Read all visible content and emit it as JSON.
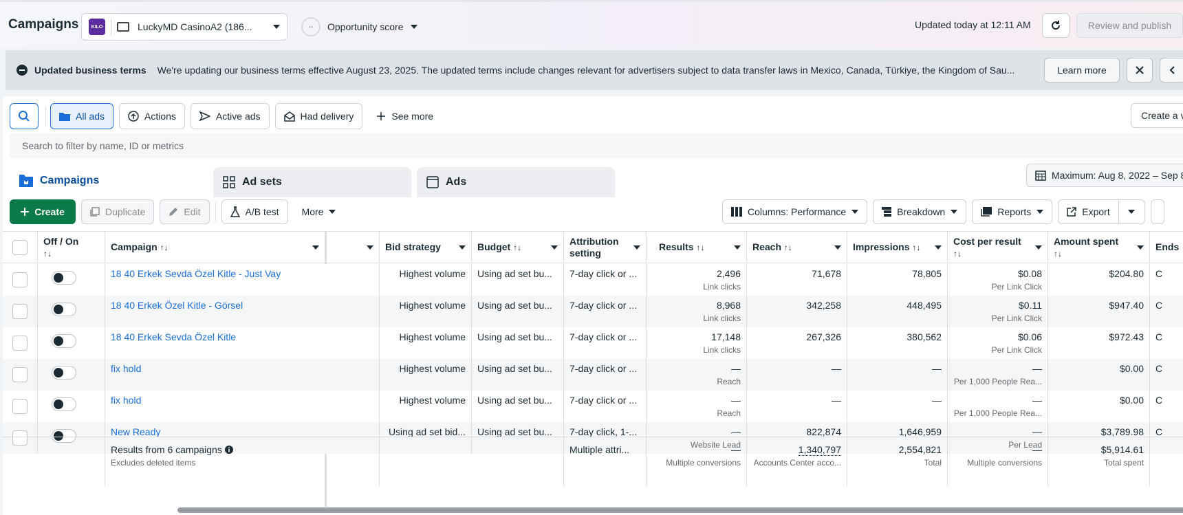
{
  "header": {
    "title": "Campaigns",
    "account_logo": "KILO",
    "account_name": "LuckyMD CasinoA2 (186...",
    "opportunity_score_badge": "--",
    "opportunity_score_label": "Opportunity score",
    "updated": "Updated today at 12:11 AM",
    "review_label": "Review and publish"
  },
  "banner": {
    "title": "Updated business terms",
    "text": "We're updating our business terms effective August 23, 2025. The updated terms include changes relevant for advertisers subject to data transfer laws in Mexico, Canada, Türkiye, the Kingdom of Sau...",
    "learn_more": "Learn more"
  },
  "filters": {
    "all_ads": "All ads",
    "actions": "Actions",
    "active_ads": "Active ads",
    "had_delivery": "Had delivery",
    "see_more": "See more",
    "create_view": "Create a v",
    "search_placeholder": "Search to filter by name, ID or metrics"
  },
  "tabs": [
    {
      "label": "Campaigns"
    },
    {
      "label": "Ad sets"
    },
    {
      "label": "Ads"
    }
  ],
  "date_range": "Maximum: Aug 8, 2022 – Sep 8",
  "toolbar": {
    "create": "Create",
    "duplicate": "Duplicate",
    "edit": "Edit",
    "ab_test": "A/B test",
    "more": "More",
    "columns": "Columns: Performance",
    "breakdown": "Breakdown",
    "reports": "Reports",
    "export": "Export"
  },
  "table": {
    "headers": {
      "off_on": "Off / On",
      "campaign": "Campaign",
      "bid_strategy": "Bid strategy",
      "budget": "Budget",
      "attribution": "Attribution setting",
      "results": "Results",
      "reach": "Reach",
      "impressions": "Impressions",
      "cost_per_result": "Cost per result",
      "amount_spent": "Amount spent",
      "ends": "Ends"
    },
    "sort_glyph": "↑↓",
    "rows": [
      {
        "campaign": "18 40 Erkek Sevda Özel Kitle - Just Vay",
        "bid": "Highest volume",
        "budget": "Using ad set bu...",
        "attribution": "7-day click or ...",
        "results": "2,496",
        "results_sub": "Link clicks",
        "reach": "71,678",
        "impressions": "78,805",
        "cpr": "$0.08",
        "cpr_sub": "Per Link Click",
        "spent": "$204.80"
      },
      {
        "campaign": "18 40 Erkek Özel Kitle - Görsel",
        "bid": "Highest volume",
        "budget": "Using ad set bu...",
        "attribution": "7-day click or ...",
        "results": "8,968",
        "results_sub": "Link clicks",
        "reach": "342,258",
        "impressions": "448,495",
        "cpr": "$0.11",
        "cpr_sub": "Per Link Click",
        "spent": "$947.40"
      },
      {
        "campaign": "18 40 Erkek Sevda Özel Kitle",
        "bid": "Highest volume",
        "budget": "Using ad set bu...",
        "attribution": "7-day click or ...",
        "results": "17,148",
        "results_sub": "Link clicks",
        "reach": "267,326",
        "impressions": "380,562",
        "cpr": "$0.06",
        "cpr_sub": "Per Link Click",
        "spent": "$972.43"
      },
      {
        "campaign": "fix hold",
        "bid": "Highest volume",
        "budget": "Using ad set bu...",
        "attribution": "7-day click or ...",
        "results": "—",
        "results_sub": "Reach",
        "reach": "—",
        "impressions": "—",
        "cpr": "—",
        "cpr_sub": "Per 1,000 People Rea...",
        "spent": "$0.00"
      },
      {
        "campaign": "fix hold",
        "bid": "Highest volume",
        "budget": "Using ad set bu...",
        "attribution": "7-day click or ...",
        "results": "—",
        "results_sub": "Reach",
        "reach": "—",
        "impressions": "—",
        "cpr": "—",
        "cpr_sub": "Per 1,000 People Rea...",
        "spent": "$0.00"
      },
      {
        "campaign": "New Ready",
        "bid": "Using ad set bid...",
        "budget": "Using ad set bu...",
        "attribution": "7-day click, 1-...",
        "results": "—",
        "results_sub": "Website Lead",
        "reach": "822,874",
        "impressions": "1,646,959",
        "cpr": "—",
        "cpr_sub": "Per Lead",
        "spent": "$3,789.98"
      }
    ],
    "ends_partial": "C",
    "totals": {
      "label": "Results from 6 campaigns",
      "sub": "Excludes deleted items",
      "attribution": "Multiple attri...",
      "results": "—",
      "results_sub": "Multiple conversions",
      "reach": "1,340,797",
      "reach_sub": "Accounts Center acco...",
      "impressions": "2,554,821",
      "impressions_sub": "Total",
      "cpr": "—",
      "cpr_sub": "Multiple conversions",
      "spent": "$5,914.61",
      "spent_sub": "Total spent"
    }
  }
}
